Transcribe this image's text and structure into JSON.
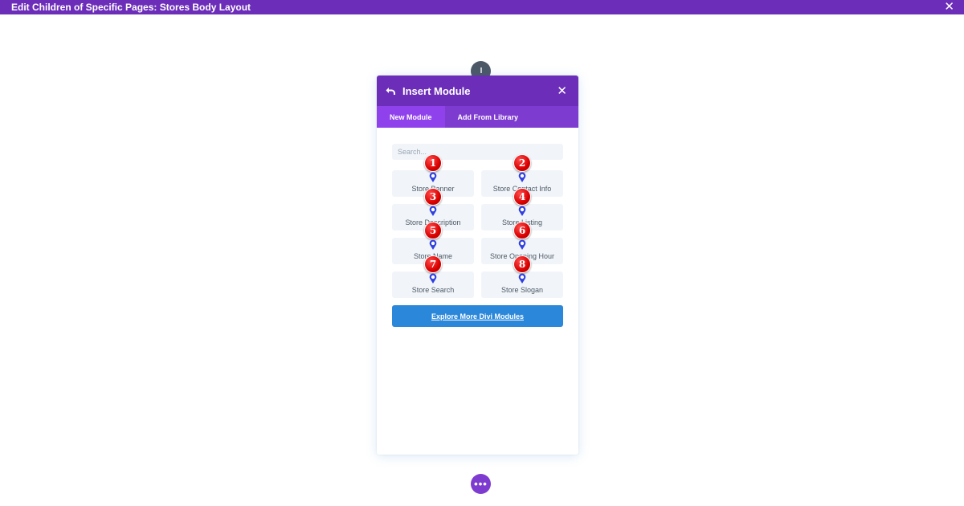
{
  "topbar": {
    "title": "Edit Children of Specific Pages: Stores Body Layout",
    "close_icon": "close-icon",
    "color": "#6c2eb9"
  },
  "modal": {
    "title": "Insert Module",
    "back_icon": "undo-arrow-icon",
    "close_icon": "close-icon",
    "tabs": [
      {
        "label": "New Module",
        "active": true
      },
      {
        "label": "Add From Library",
        "active": false
      }
    ],
    "search": {
      "placeholder": "Search...",
      "value": ""
    },
    "modules": [
      {
        "badge": "1",
        "label": "Store Banner",
        "icon": "map-pin-icon"
      },
      {
        "badge": "2",
        "label": "Store Contact Info",
        "icon": "map-pin-icon"
      },
      {
        "badge": "3",
        "label": "Store Description",
        "icon": "map-pin-icon"
      },
      {
        "badge": "4",
        "label": "Store Listing",
        "icon": "map-pin-icon"
      },
      {
        "badge": "5",
        "label": "Store Name",
        "icon": "map-pin-icon"
      },
      {
        "badge": "6",
        "label": "Store Opening Hour",
        "icon": "map-pin-icon"
      },
      {
        "badge": "7",
        "label": "Store Search",
        "icon": "map-pin-icon"
      },
      {
        "badge": "8",
        "label": "Store Slogan",
        "icon": "map-pin-icon"
      }
    ],
    "explore_label": "Explore More Divi Modules"
  },
  "bottom_button": {
    "label": "•••",
    "icon": "more-dots-icon"
  },
  "colors": {
    "purple": "#6c2eb9",
    "tab_active": "#8f42ec",
    "blue": "#2b87da",
    "badge_red": "#d90000",
    "icon_blue": "#2f3fe0"
  }
}
